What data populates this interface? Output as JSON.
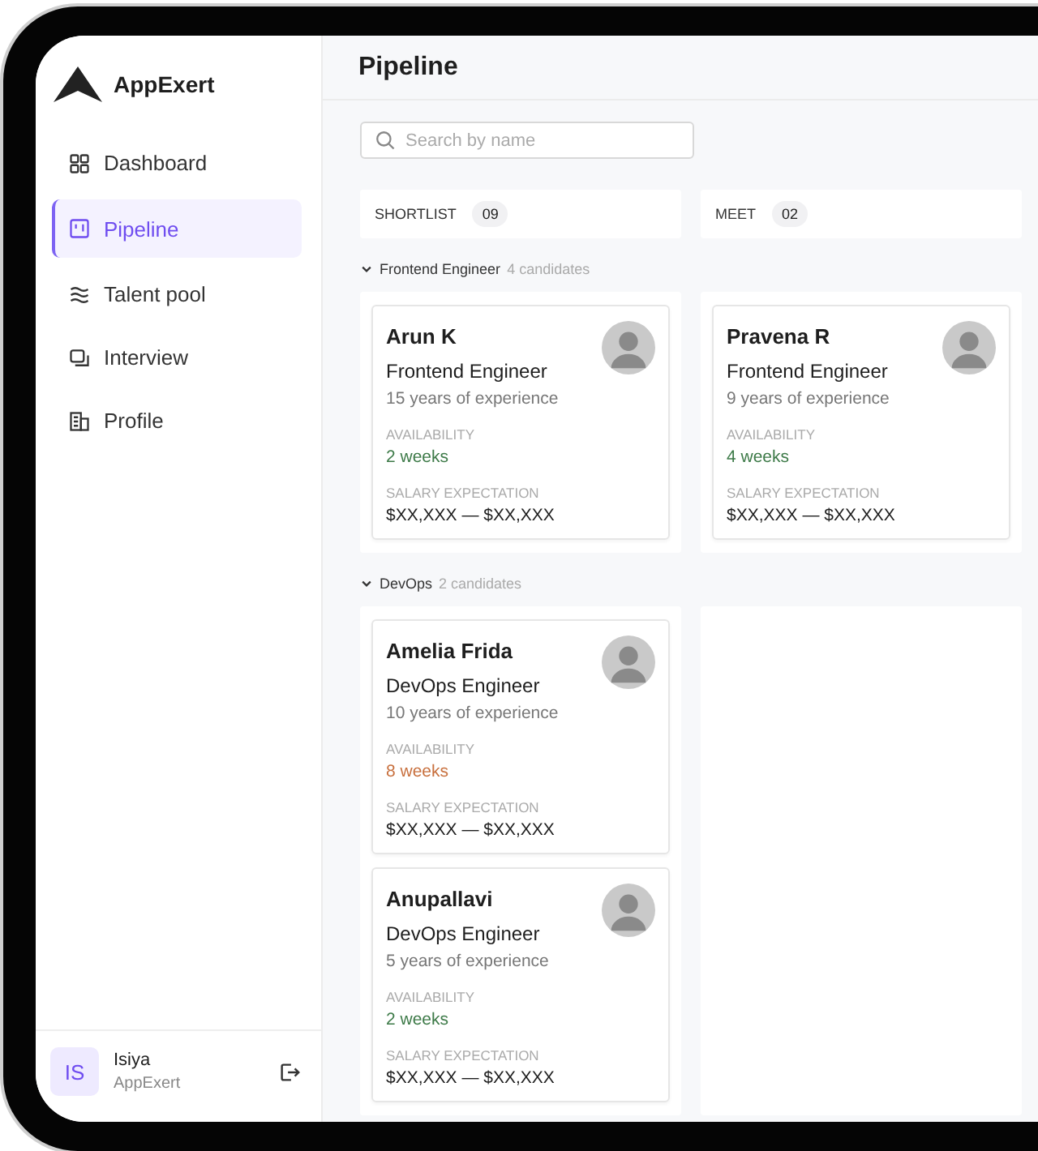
{
  "brand": {
    "name": "AppExert"
  },
  "nav": [
    {
      "label": "Dashboard",
      "selected": false
    },
    {
      "label": "Pipeline",
      "selected": true
    },
    {
      "label": "Talent pool",
      "selected": false
    },
    {
      "label": "Interview",
      "selected": false
    },
    {
      "label": "Profile",
      "selected": false
    }
  ],
  "user": {
    "initials": "IS",
    "name": "Isiya",
    "org": "AppExert"
  },
  "page_title": "Pipeline",
  "search": {
    "placeholder": "Search by name"
  },
  "stages": [
    {
      "label": "SHORTLIST",
      "count": "09"
    },
    {
      "label": "MEET",
      "count": "02"
    }
  ],
  "groups": [
    {
      "title": "Frontend Engineer",
      "count_text": "4 candidates",
      "expanded": true,
      "columns": [
        [
          {
            "name": "Arun K",
            "role": "Frontend Engineer",
            "experience": "15 years of experience",
            "availability_label": "AVAILABILITY",
            "availability": "2 weeks",
            "color": "#3d7a48",
            "salary_label": "SALARY EXPECTATION",
            "salary": "$XX,XXX — $XX,XXX"
          }
        ],
        [
          {
            "name": "Pravena R",
            "role": "Frontend Engineer",
            "experience": "9 years of experience",
            "availability_label": "AVAILABILITY",
            "availability": "4 weeks",
            "color": "#3d7a48",
            "salary_label": "SALARY EXPECTATION",
            "salary": "$XX,XXX — $XX,XXX"
          }
        ]
      ]
    },
    {
      "title": "DevOps",
      "count_text": "2 candidates",
      "expanded": true,
      "columns": [
        [
          {
            "name": "Amelia Frida",
            "role": "DevOps Engineer",
            "experience": "10 years of experience",
            "availability_label": "AVAILABILITY",
            "availability": "8 weeks",
            "color": "#c8703e",
            "salary_label": "SALARY EXPECTATION",
            "salary": "$XX,XXX — $XX,XXX"
          },
          {
            "name": "Anupallavi",
            "role": "DevOps Engineer",
            "experience": "5 years of experience",
            "availability_label": "AVAILABILITY",
            "availability": "2 weeks",
            "color": "#3d7a48",
            "salary_label": "SALARY EXPECTATION",
            "salary": "$XX,XXX — $XX,XXX"
          }
        ],
        []
      ]
    }
  ]
}
